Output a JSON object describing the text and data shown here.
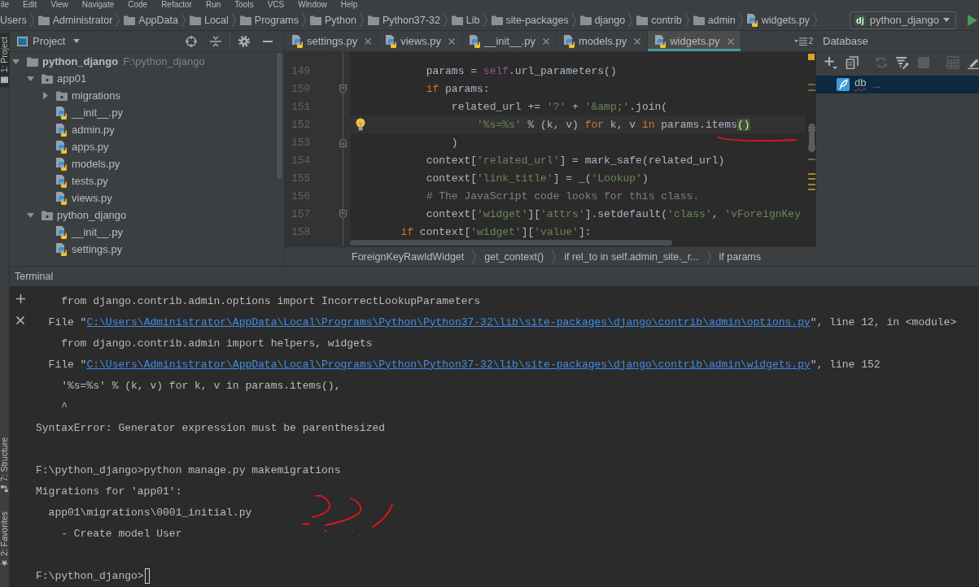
{
  "menu_bar": {
    "items": [
      "ile",
      "Edit",
      "View",
      "Navigate",
      "Code",
      "Refactor",
      "Run",
      "Tools",
      "VCS",
      "Window",
      "Help"
    ]
  },
  "nav_bar": {
    "crumbs": [
      {
        "label": "Users",
        "kind": "plain"
      },
      {
        "label": "Administrator",
        "kind": "folder"
      },
      {
        "label": "AppData",
        "kind": "folder"
      },
      {
        "label": "Local",
        "kind": "folder"
      },
      {
        "label": "Programs",
        "kind": "folder"
      },
      {
        "label": "Python",
        "kind": "folder"
      },
      {
        "label": "Python37-32",
        "kind": "folder"
      },
      {
        "label": "Lib",
        "kind": "folder"
      },
      {
        "label": "site-packages",
        "kind": "folder"
      },
      {
        "label": "django",
        "kind": "folder"
      },
      {
        "label": "contrib",
        "kind": "folder"
      },
      {
        "label": "admin",
        "kind": "folder"
      },
      {
        "label": "widgets.py",
        "kind": "python"
      }
    ],
    "run_config": {
      "badge": "dj",
      "label": "python_django"
    }
  },
  "tool_strip": {
    "top": [
      {
        "label": "1: Project",
        "kind": "project",
        "selected": true
      }
    ],
    "bottom": [
      {
        "label": "7: Structure",
        "kind": "structure",
        "selected": false
      },
      {
        "label": "2: Favorites",
        "kind": "favorites",
        "selected": false
      }
    ]
  },
  "project": {
    "title": "Project",
    "tree": [
      {
        "label": "python_django",
        "path": "F:\\python_django",
        "kind": "root",
        "expanded": true,
        "children": [
          {
            "label": "app01",
            "kind": "package",
            "expanded": true,
            "children": [
              {
                "label": "migrations",
                "kind": "package",
                "expanded": false
              },
              {
                "label": "__init__.py",
                "kind": "python"
              },
              {
                "label": "admin.py",
                "kind": "python"
              },
              {
                "label": "apps.py",
                "kind": "python"
              },
              {
                "label": "models.py",
                "kind": "python"
              },
              {
                "label": "tests.py",
                "kind": "python"
              },
              {
                "label": "views.py",
                "kind": "python"
              }
            ]
          },
          {
            "label": "python_django",
            "kind": "package",
            "expanded": true,
            "children": [
              {
                "label": "__init__.py",
                "kind": "python"
              },
              {
                "label": "settings.py",
                "kind": "python"
              }
            ]
          }
        ]
      }
    ]
  },
  "editor": {
    "tabs": [
      {
        "label": "settings.py",
        "selected": false
      },
      {
        "label": "views.py",
        "selected": false
      },
      {
        "label": "__init__.py",
        "selected": false
      },
      {
        "label": "models.py",
        "selected": false
      },
      {
        "label": "widgets.py",
        "selected": true
      }
    ],
    "overflow_count": "2",
    "lines": [
      {
        "number": "149",
        "current": false,
        "hint": false,
        "fold_start": false,
        "fold_end": false,
        "tokens": [
          {
            "kind": "plain",
            "text": "            params = "
          },
          {
            "kind": "self",
            "text": "self"
          },
          {
            "kind": "plain",
            "text": ".url_parameters()"
          }
        ]
      },
      {
        "number": "150",
        "current": false,
        "hint": false,
        "fold_start": true,
        "fold_end": false,
        "tokens": [
          {
            "kind": "kw",
            "text": "            if"
          },
          {
            "kind": "plain",
            "text": " params:"
          }
        ]
      },
      {
        "number": "151",
        "current": false,
        "hint": false,
        "fold_start": false,
        "fold_end": false,
        "tokens": [
          {
            "kind": "plain",
            "text": "                related_url += "
          },
          {
            "kind": "str",
            "text": "'?'"
          },
          {
            "kind": "plain",
            "text": " + "
          },
          {
            "kind": "str",
            "text": "'&amp;'"
          },
          {
            "kind": "plain",
            "text": ".join("
          }
        ]
      },
      {
        "number": "152",
        "current": true,
        "hint": true,
        "fold_start": false,
        "fold_end": false,
        "tokens": [
          {
            "kind": "str",
            "text": "                    '%s=%s'"
          },
          {
            "kind": "plain",
            "text": " % (k, v) "
          },
          {
            "kind": "kw",
            "text": "for"
          },
          {
            "kind": "plain",
            "text": " k, v "
          },
          {
            "kind": "kw",
            "text": "in"
          },
          {
            "kind": "plain",
            "text": " params.items"
          },
          {
            "kind": "match",
            "text": "()"
          }
        ]
      },
      {
        "number": "153",
        "current": false,
        "hint": false,
        "fold_start": false,
        "fold_end": true,
        "tokens": [
          {
            "kind": "plain",
            "text": "                )"
          }
        ]
      },
      {
        "number": "154",
        "current": false,
        "hint": false,
        "fold_start": false,
        "fold_end": false,
        "tokens": [
          {
            "kind": "plain",
            "text": "            context["
          },
          {
            "kind": "str",
            "text": "'related_url'"
          },
          {
            "kind": "plain",
            "text": "] = mark_safe(related_url)"
          }
        ]
      },
      {
        "number": "155",
        "current": false,
        "hint": false,
        "fold_start": false,
        "fold_end": false,
        "tokens": [
          {
            "kind": "plain",
            "text": "            context["
          },
          {
            "kind": "str",
            "text": "'link_title'"
          },
          {
            "kind": "plain",
            "text": "] = _("
          },
          {
            "kind": "str",
            "text": "'Lookup'"
          },
          {
            "kind": "plain",
            "text": ")"
          }
        ]
      },
      {
        "number": "156",
        "current": false,
        "hint": false,
        "fold_start": false,
        "fold_end": false,
        "tokens": [
          {
            "kind": "comment",
            "text": "            # The JavaScript code looks for this class."
          }
        ]
      },
      {
        "number": "157",
        "current": false,
        "hint": false,
        "fold_start": true,
        "fold_end": false,
        "tokens": [
          {
            "kind": "plain",
            "text": "            context["
          },
          {
            "kind": "str",
            "text": "'widget'"
          },
          {
            "kind": "plain",
            "text": "]["
          },
          {
            "kind": "str",
            "text": "'attrs'"
          },
          {
            "kind": "plain",
            "text": "].setdefault("
          },
          {
            "kind": "str",
            "text": "'class'"
          },
          {
            "kind": "plain",
            "text": ", "
          },
          {
            "kind": "str",
            "text": "'vForeignKey"
          }
        ]
      },
      {
        "number": "158",
        "current": false,
        "hint": false,
        "fold_start": false,
        "fold_end": false,
        "tokens": [
          {
            "kind": "kw",
            "text": "        if"
          },
          {
            "kind": "plain",
            "text": " context["
          },
          {
            "kind": "str",
            "text": "'widget'"
          },
          {
            "kind": "plain",
            "text": "]["
          },
          {
            "kind": "str",
            "text": "'value'"
          },
          {
            "kind": "plain",
            "text": "]:"
          }
        ]
      }
    ],
    "breadcrumbs": [
      "ForeignKeyRawIdWidget",
      "get_context()",
      "if rel_to in self.admin_site._r...",
      "if params"
    ]
  },
  "database": {
    "title": "Database",
    "tool_groups": [
      {
        "tools": [
          {
            "kind": "add",
            "disabled": false
          },
          {
            "kind": "copy",
            "disabled": false
          }
        ]
      },
      {
        "tools": [
          {
            "kind": "refresh",
            "disabled": true
          },
          {
            "kind": "filter",
            "disabled": false
          },
          {
            "kind": "stop",
            "disabled": true
          }
        ]
      },
      {
        "tools": [
          {
            "kind": "table",
            "disabled": true
          },
          {
            "kind": "edit",
            "disabled": false
          }
        ]
      }
    ],
    "items": [
      {
        "label": "db",
        "suffix": "...",
        "selected": true,
        "misspelled": true
      }
    ]
  },
  "terminal": {
    "title": "Terminal",
    "cursor": true,
    "lines": [
      {
        "kind": "output",
        "parts": [
          {
            "kind": "text",
            "text": "    from django.contrib.admin.options import IncorrectLookupParameters"
          }
        ]
      },
      {
        "kind": "output",
        "parts": [
          {
            "kind": "text",
            "text": "  File \""
          },
          {
            "kind": "link",
            "text": "C:\\Users\\Administrator\\AppData\\Local\\Programs\\Python\\Python37-32\\lib\\site-packages\\django\\contrib\\admin\\options.py"
          },
          {
            "kind": "text",
            "text": "\", line 12, in <module>"
          }
        ]
      },
      {
        "kind": "output",
        "parts": [
          {
            "kind": "text",
            "text": "    from django.contrib.admin import helpers, widgets"
          }
        ]
      },
      {
        "kind": "output",
        "parts": [
          {
            "kind": "text",
            "text": "  File \""
          },
          {
            "kind": "link",
            "text": "C:\\Users\\Administrator\\AppData\\Local\\Programs\\Python\\Python37-32\\lib\\site-packages\\django\\contrib\\admin\\widgets.py"
          },
          {
            "kind": "text",
            "text": "\", line 152"
          }
        ]
      },
      {
        "kind": "output",
        "parts": [
          {
            "kind": "text",
            "text": "    '%s=%s' % (k, v) for k, v in params.items(),"
          }
        ]
      },
      {
        "kind": "output",
        "parts": [
          {
            "kind": "text",
            "text": "    ^"
          }
        ]
      },
      {
        "kind": "output",
        "parts": [
          {
            "kind": "text",
            "text": "SyntaxError: Generator expression must be parenthesized"
          }
        ]
      },
      {
        "kind": "blank"
      },
      {
        "kind": "output",
        "parts": [
          {
            "kind": "text",
            "text": "F:\\python_django>python manage.py makemigrations"
          }
        ]
      },
      {
        "kind": "output",
        "parts": [
          {
            "kind": "text",
            "text": "Migrations for 'app01':"
          }
        ]
      },
      {
        "kind": "output",
        "parts": [
          {
            "kind": "text",
            "text": "  app01\\migrations\\0001_initial.py"
          }
        ]
      },
      {
        "kind": "output",
        "parts": [
          {
            "kind": "text",
            "text": "    - Create model User"
          }
        ]
      },
      {
        "kind": "blank"
      },
      {
        "kind": "output",
        "parts": [
          {
            "kind": "text",
            "text": "F:\\python_django>"
          }
        ]
      }
    ]
  }
}
